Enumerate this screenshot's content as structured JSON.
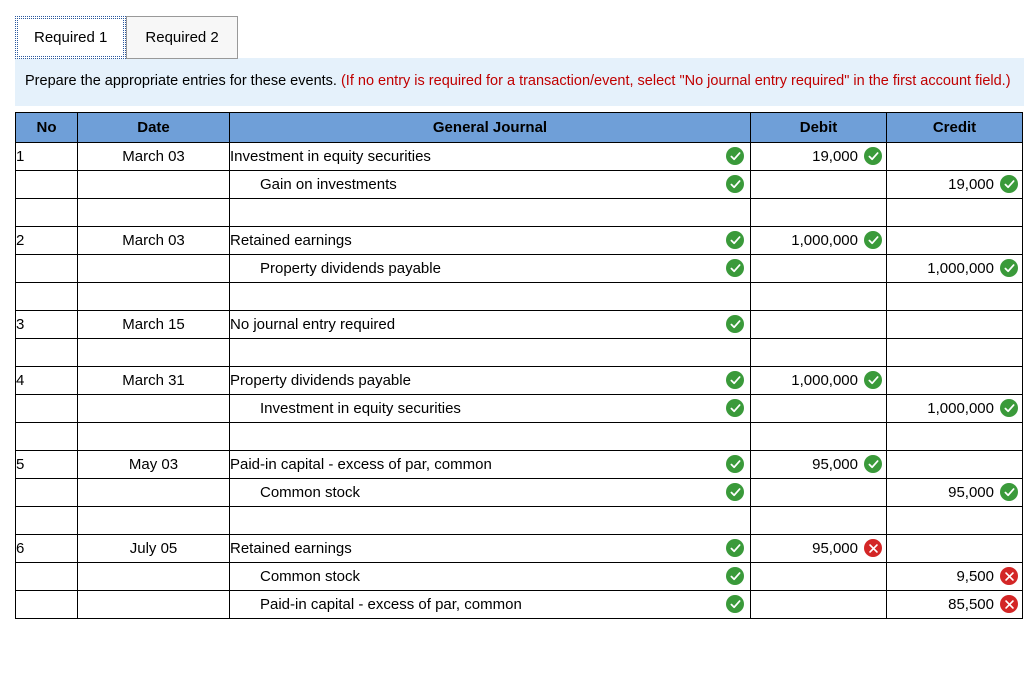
{
  "tabs": {
    "t1": "Required 1",
    "t2": "Required 2"
  },
  "instructions": {
    "black": "Prepare the appropriate entries for these events. ",
    "red": "(If no entry is required for a transaction/event, select \"No journal entry required\" in the first account field.)"
  },
  "headers": {
    "no": "No",
    "date": "Date",
    "gj": "General Journal",
    "debit": "Debit",
    "credit": "Credit"
  },
  "rows": [
    {
      "no": "1",
      "date": "March 03",
      "acct": "Investment in equity securities",
      "indent": false,
      "acct_status": "ok",
      "debit": "19,000",
      "debit_status": "ok",
      "credit": "",
      "credit_status": ""
    },
    {
      "no": "",
      "date": "",
      "acct": "Gain on investments",
      "indent": true,
      "acct_status": "ok",
      "debit": "",
      "debit_status": "",
      "credit": "19,000",
      "credit_status": "ok"
    },
    {
      "spacer": true
    },
    {
      "no": "2",
      "date": "March 03",
      "acct": "Retained earnings",
      "indent": false,
      "acct_status": "ok",
      "debit": "1,000,000",
      "debit_status": "ok",
      "credit": "",
      "credit_status": ""
    },
    {
      "no": "",
      "date": "",
      "acct": "Property dividends payable",
      "indent": true,
      "acct_status": "ok",
      "debit": "",
      "debit_status": "",
      "credit": "1,000,000",
      "credit_status": "ok"
    },
    {
      "spacer": true
    },
    {
      "no": "3",
      "date": "March 15",
      "acct": "No journal entry required",
      "indent": false,
      "acct_status": "ok",
      "debit": "",
      "debit_status": "",
      "credit": "",
      "credit_status": ""
    },
    {
      "spacer": true
    },
    {
      "no": "4",
      "date": "March 31",
      "acct": "Property dividends payable",
      "indent": false,
      "acct_status": "ok",
      "debit": "1,000,000",
      "debit_status": "ok",
      "credit": "",
      "credit_status": ""
    },
    {
      "no": "",
      "date": "",
      "acct": "Investment in equity securities",
      "indent": true,
      "acct_status": "ok",
      "debit": "",
      "debit_status": "",
      "credit": "1,000,000",
      "credit_status": "ok"
    },
    {
      "spacer": true
    },
    {
      "no": "5",
      "date": "May 03",
      "acct": "Paid-in capital - excess of par, common",
      "indent": false,
      "acct_status": "ok",
      "debit": "95,000",
      "debit_status": "ok",
      "credit": "",
      "credit_status": ""
    },
    {
      "no": "",
      "date": "",
      "acct": "Common stock",
      "indent": true,
      "acct_status": "ok",
      "debit": "",
      "debit_status": "",
      "credit": "95,000",
      "credit_status": "ok"
    },
    {
      "spacer": true
    },
    {
      "no": "6",
      "date": "July 05",
      "acct": "Retained earnings",
      "indent": false,
      "acct_status": "ok",
      "debit": "95,000",
      "debit_status": "bad",
      "credit": "",
      "credit_status": ""
    },
    {
      "no": "",
      "date": "",
      "acct": "Common stock",
      "indent": true,
      "acct_status": "ok",
      "debit": "",
      "debit_status": "",
      "credit": "9,500",
      "credit_status": "bad"
    },
    {
      "no": "",
      "date": "",
      "acct": "Paid-in capital - excess of par, common",
      "indent": true,
      "acct_status": "ok",
      "debit": "",
      "debit_status": "",
      "credit": "85,500",
      "credit_status": "bad"
    }
  ]
}
